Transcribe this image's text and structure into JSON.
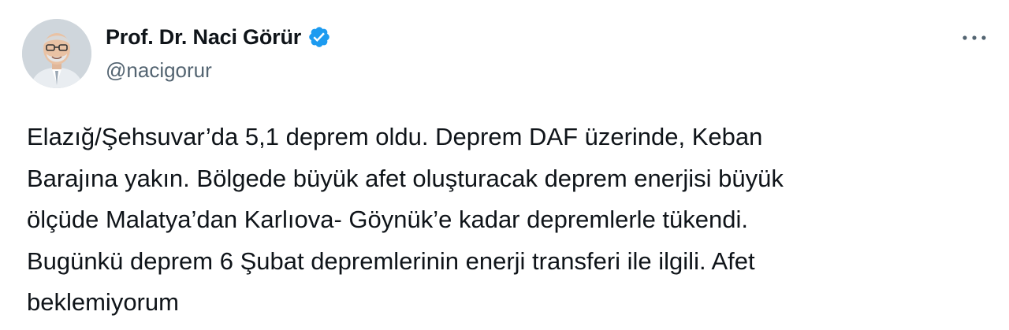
{
  "author": {
    "display_name": "Prof. Dr. Naci Görür",
    "handle": "@nacigorur",
    "verified": true,
    "verified_icon": "verified-badge-icon",
    "avatar_icon": "profile-photo"
  },
  "menu": {
    "more_icon": "more-horizontal-icon"
  },
  "tweet": {
    "text": "Elazığ/Şehsuvar’da 5,1 deprem oldu. Deprem DAF üzerinde, Keban\nBarajına yakın. Bölgede büyük afet oluşturacak deprem enerjisi büyük\nölçüde Malatya’dan Karlıova- Göynük’e kadar depremlerle tükendi.\nBugünkü deprem 6 Şubat depremlerinin enerji transferi ile ilgili. Afet\nbeklemiyorum"
  },
  "colors": {
    "text_primary": "#0f1419",
    "text_secondary": "#536471",
    "verified_blue": "#1d9bf0"
  }
}
